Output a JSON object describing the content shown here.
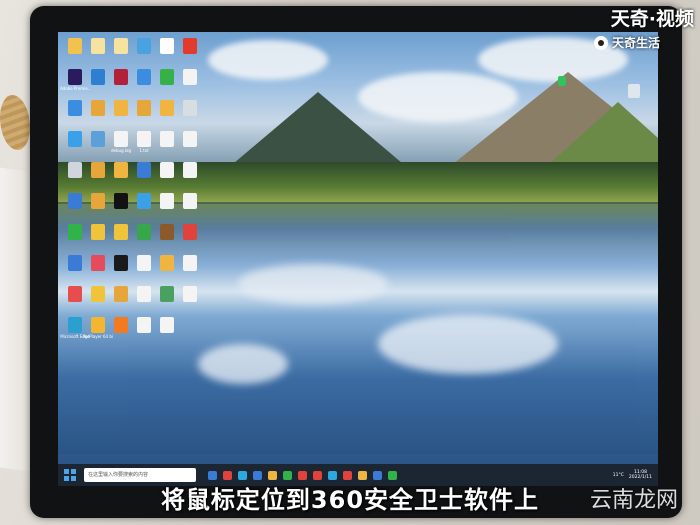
{
  "caption": "将鼠标定位到360安全卫士软件上",
  "watermark_top": "天奇·视频",
  "watermark_sub": "天奇生活",
  "watermark_bottom": "云南龙网",
  "taskbar": {
    "search_placeholder": "在这里输入你要搜索的内容",
    "tray_temp": "11°C",
    "clock_time": "11:08",
    "clock_date": "2022/1/11"
  },
  "desktop_icons": [
    {
      "label": "",
      "color": "#f2c14e"
    },
    {
      "label": "",
      "color": "#f7e2a0"
    },
    {
      "label": "",
      "color": "#f7e2a0"
    },
    {
      "label": "",
      "color": "#4aa3e0"
    },
    {
      "label": "",
      "color": "#ffffff"
    },
    {
      "label": "",
      "color": "#e23b2e"
    },
    {
      "label": "Adobe Premie...",
      "color": "#2a1a5e"
    },
    {
      "label": "",
      "color": "#2f7fd0"
    },
    {
      "label": "",
      "color": "#b2203a"
    },
    {
      "label": "",
      "color": "#3b8de0"
    },
    {
      "label": "",
      "color": "#38b04a"
    },
    {
      "label": "",
      "color": "#f3f3f3"
    },
    {
      "label": "",
      "color": "#3b8de0"
    },
    {
      "label": "",
      "color": "#e6a63a"
    },
    {
      "label": "",
      "color": "#f0b540"
    },
    {
      "label": "",
      "color": "#e6a63a"
    },
    {
      "label": "",
      "color": "#f0b540"
    },
    {
      "label": "",
      "color": "#d8dde2"
    },
    {
      "label": "",
      "color": "#3aa0e8"
    },
    {
      "label": "",
      "color": "#5da0d8"
    },
    {
      "label": "debug.log",
      "color": "#f4f4f4"
    },
    {
      "label": "1.txt",
      "color": "#f4f4f4"
    },
    {
      "label": "",
      "color": "#f4f4f4"
    },
    {
      "label": "",
      "color": "#f4f4f4"
    },
    {
      "label": "",
      "color": "#d0d6dc"
    },
    {
      "label": "",
      "color": "#e6a63a"
    },
    {
      "label": "",
      "color": "#f0b540"
    },
    {
      "label": "",
      "color": "#3a7bd5"
    },
    {
      "label": "",
      "color": "#f4f4f4"
    },
    {
      "label": "",
      "color": "#f4f4f4"
    },
    {
      "label": "",
      "color": "#3a7bd5"
    },
    {
      "label": "",
      "color": "#e6a63a"
    },
    {
      "label": "",
      "color": "#121212"
    },
    {
      "label": "",
      "color": "#3aa0e8"
    },
    {
      "label": "",
      "color": "#f4f4f4"
    },
    {
      "label": "",
      "color": "#f4f4f4"
    },
    {
      "label": "",
      "color": "#32b34a"
    },
    {
      "label": "",
      "color": "#f0c43a"
    },
    {
      "label": "",
      "color": "#f0c43a"
    },
    {
      "label": "",
      "color": "#38a64a"
    },
    {
      "label": "",
      "color": "#8a5a2a"
    },
    {
      "label": "",
      "color": "#e0433b"
    },
    {
      "label": "",
      "color": "#3a7bd5"
    },
    {
      "label": "",
      "color": "#e44b5b"
    },
    {
      "label": "",
      "color": "#1a1a1a"
    },
    {
      "label": "",
      "color": "#f4f4f4"
    },
    {
      "label": "",
      "color": "#f0b540"
    },
    {
      "label": "",
      "color": "#f4f4f4"
    },
    {
      "label": "",
      "color": "#e84d4d"
    },
    {
      "label": "",
      "color": "#f0c43a"
    },
    {
      "label": "",
      "color": "#e6a63a"
    },
    {
      "label": "",
      "color": "#f4f4f4"
    },
    {
      "label": "",
      "color": "#4aa060"
    },
    {
      "label": "",
      "color": "#f4f4f4"
    },
    {
      "label": "Microsoft Edge",
      "color": "#2a9fd0"
    },
    {
      "label": "PotPlayer 64 bit",
      "color": "#f3b630"
    },
    {
      "label": "",
      "color": "#f47a20"
    },
    {
      "label": "",
      "color": "#f4f4f4"
    },
    {
      "label": "",
      "color": "#f4f4f4"
    }
  ],
  "taskbar_apps": [
    "#3a7bd5",
    "#e0433b",
    "#2ea8e0",
    "#3a7bd5",
    "#f0b540",
    "#32b34a",
    "#e0433b",
    "#e0433b",
    "#2ea8e0",
    "#e0433b",
    "#f0b540",
    "#3a7bd5",
    "#32b34a"
  ]
}
